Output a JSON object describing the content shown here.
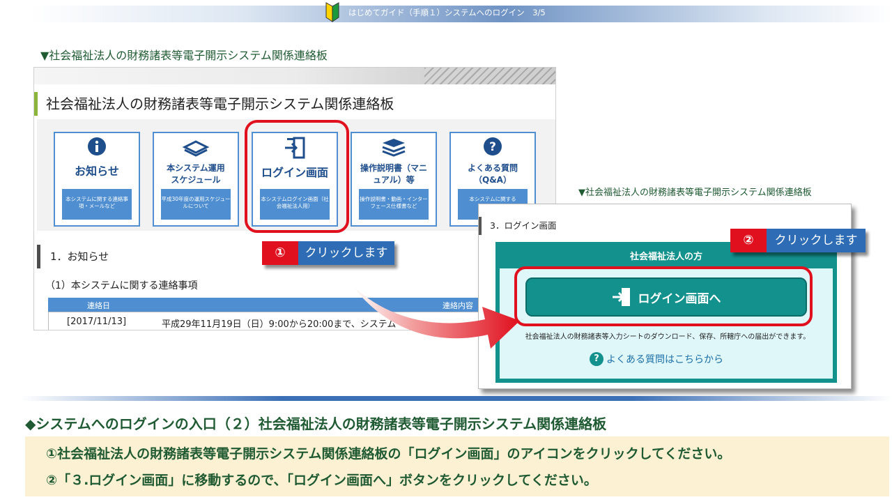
{
  "header": {
    "icon": "beginner-mark-icon",
    "title": "はじめてガイド（手順１）システムへのログイン　3/5"
  },
  "captions": {
    "top": "▼社会福祉法人の財務諸表等電子開示システム関係連絡板",
    "right": "▼社会福祉法人の財務諸表等電子開示システム関係連絡板"
  },
  "bulletin": {
    "title": "社会福祉法人の財務諸表等電子開示システム関係連絡板",
    "tiles": [
      {
        "icon": "info-icon",
        "title": "お知らせ",
        "subtitle": "本システムに関する連絡事項・メールなど"
      },
      {
        "icon": "book-icon",
        "title": "本システム運用スケジュール",
        "subtitle": "平成30年度の運用スケジュールについて"
      },
      {
        "icon": "login-door-icon",
        "title": "ログイン画面",
        "subtitle": "本システムログイン画面（社会福祉法人用）"
      },
      {
        "icon": "books-stack-icon",
        "title": "操作説明書（マニュアル）等",
        "subtitle": "操作説明書・動画・インターフェース仕様書など"
      },
      {
        "icon": "question-icon",
        "title": "よくある質問（Q&A）",
        "subtitle": "本システムに関する"
      }
    ],
    "section_title": "1．お知らせ",
    "sub_title": "（1）本システムに関する連絡事項",
    "table": {
      "headers": [
        "連絡日",
        "連絡内容"
      ],
      "rows": [
        {
          "date": "[2017/11/13]",
          "content": "平成29年11月19日（日）9:00から20:00まで、システム"
        }
      ]
    }
  },
  "callouts": [
    {
      "number": "①",
      "label": "クリックします"
    },
    {
      "number": "②",
      "label": "クリックします"
    }
  ],
  "login_page": {
    "section_title": "3．ログイン画面",
    "panel_title": "社会福祉法人の方",
    "login_button": "ログイン画面へ",
    "description": "社会福祉法人の財務諸表等入力シートのダウンロード、保存、所轄庁への届出ができます。",
    "faq_link": "よくある質問はこちらから"
  },
  "instructions": {
    "title": "◆システムへのログインの入口（２）社会福祉法人の財務諸表等電子開示システム関係連絡板",
    "steps": [
      "①社会福祉法人の財務諸表等電子開示システム関係連絡板の「ログイン画面」のアイコンをクリックしてください。",
      "②「３.ログイン画面」に移動するので、「ログイン画面へ」ボタンをクリックしてください。"
    ]
  },
  "colors": {
    "accent_blue": "#4f8fd1",
    "teal": "#13918d",
    "highlight_red": "#e0101e",
    "text_green": "#1f5a32"
  }
}
